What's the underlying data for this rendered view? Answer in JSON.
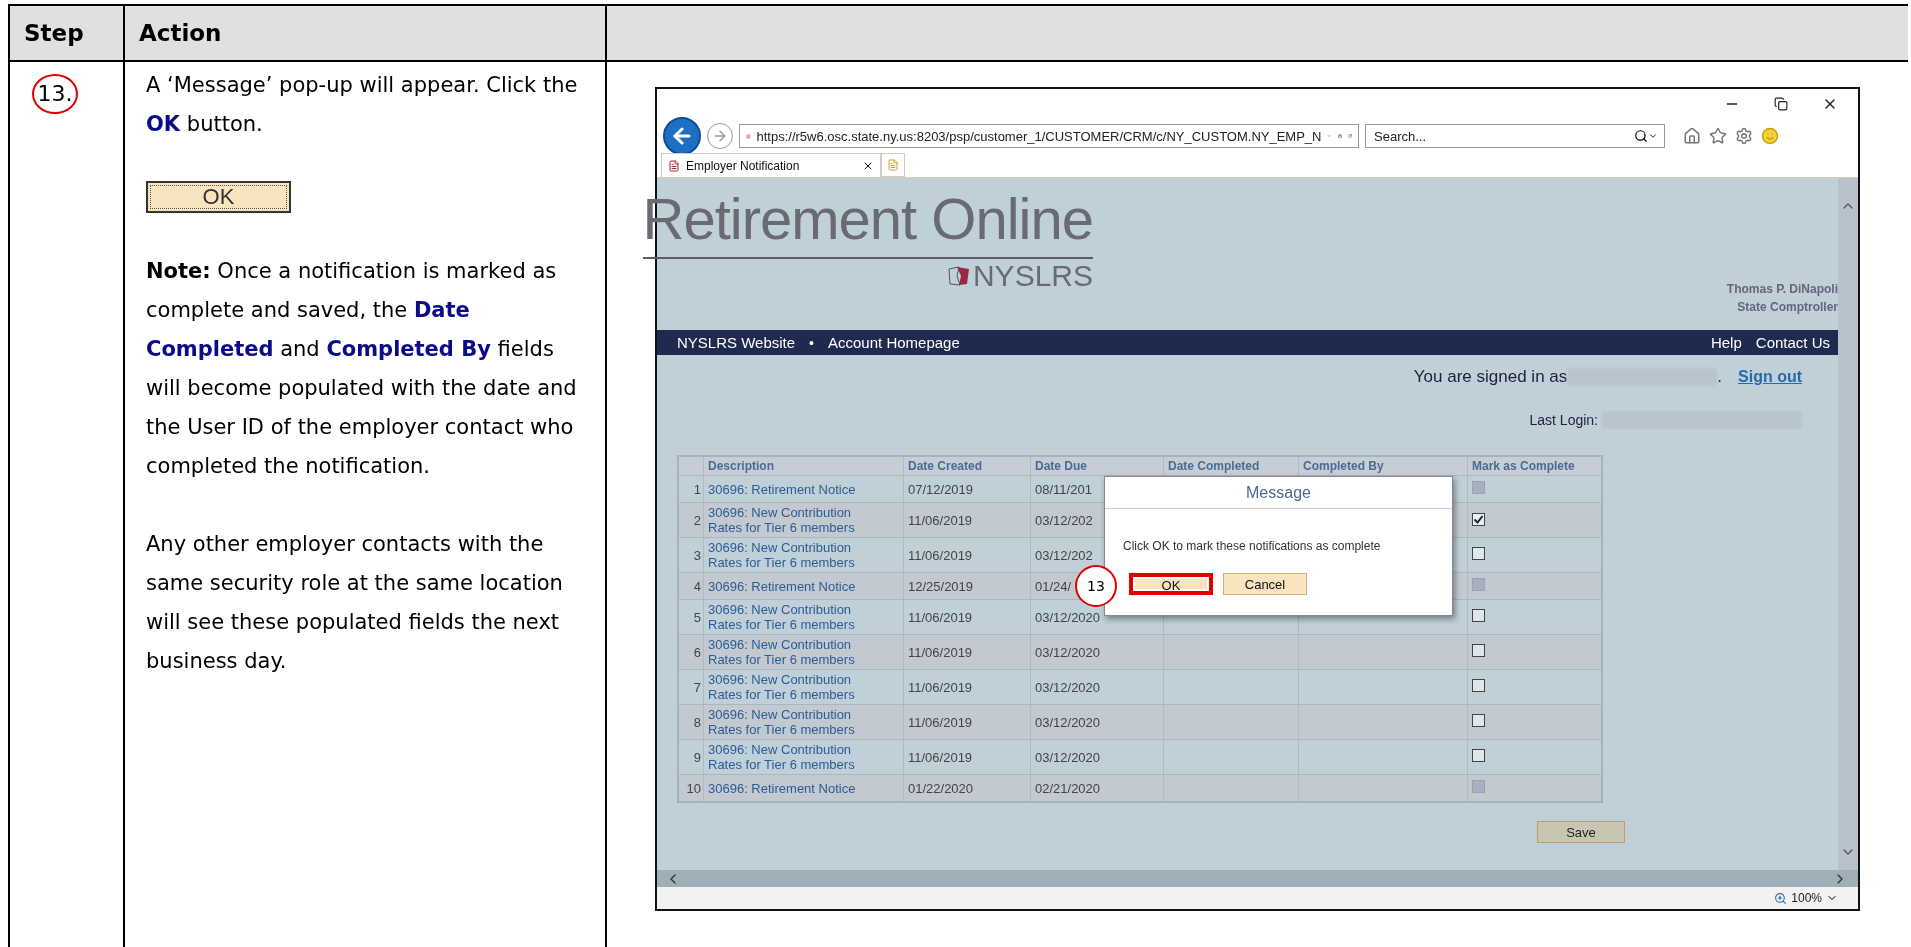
{
  "table": {
    "columns": [
      "Step",
      "Action"
    ]
  },
  "step": {
    "number": "13."
  },
  "instructions": [
    {
      "kind": "text",
      "segments": [
        {
          "kind": "plain",
          "text": "A ‘Message’ pop-up will appear.  Click the "
        },
        {
          "kind": "term",
          "text": "OK"
        },
        {
          "kind": "plain",
          "text": " button."
        }
      ]
    },
    {
      "kind": "button",
      "label": "OK"
    },
    {
      "kind": "text",
      "segments": [
        {
          "kind": "label",
          "text": "Note:"
        },
        {
          "kind": "plain",
          "text": " Once a notification is marked as complete and saved, the "
        },
        {
          "kind": "term",
          "text": "Date Completed"
        },
        {
          "kind": "plain",
          "text": " and "
        },
        {
          "kind": "term",
          "text": "Completed By"
        },
        {
          "kind": "plain",
          "text": " fields will become populated with the date and the User ID of the employer contact who completed the notification."
        }
      ]
    },
    {
      "kind": "text",
      "segments": [
        {
          "kind": "plain",
          "text": "Any other employer contacts with the same security role at the same location will see these populated fields the next business day."
        }
      ]
    }
  ],
  "browser": {
    "url": "https://r5w6.osc.state.ny.us:8203/psp/customer_1/CUSTOMER/CRM/c/NY_CUSTOM.NY_EMP_N",
    "search": {
      "placeholder": "Search..."
    },
    "tab": {
      "title": "Employer Notification"
    },
    "zoom": "100%"
  },
  "site": {
    "logo_title": "Retirement Online",
    "logo_subtitle": "NYSLRS",
    "official_name": "Thomas P. DiNapoli",
    "official_title": "State Comptroller",
    "nav_left": [
      "NYSLRS Website",
      "Account Homepage"
    ],
    "nav_separator": "•",
    "nav_right": [
      "Help",
      "Contact Us"
    ],
    "signed_in_label": "You are signed in as",
    "signed_in_period": ".",
    "sign_out": "Sign out",
    "last_login_label": "Last Login:"
  },
  "grid": {
    "columns": [
      "Description",
      "Date Created",
      "Date Due",
      "Date Completed",
      "Completed By",
      "Mark as Complete"
    ],
    "rows": [
      {
        "number": "1",
        "description": "30696: Retirement Notice",
        "date_created": "07/12/2019",
        "date_due": "08/11/201",
        "checked": false,
        "disabled": true
      },
      {
        "number": "2",
        "description": "30696: New Contribution Rates for Tier 6 members",
        "date_created": "11/06/2019",
        "date_due": "03/12/202",
        "checked": true,
        "disabled": false
      },
      {
        "number": "3",
        "description": "30696: New Contribution Rates for Tier 6 members",
        "date_created": "11/06/2019",
        "date_due": "03/12/202",
        "checked": false,
        "disabled": false
      },
      {
        "number": "4",
        "description": "30696: Retirement Notice",
        "date_created": "12/25/2019",
        "date_due": "01/24/",
        "checked": false,
        "disabled": true
      },
      {
        "number": "5",
        "description": "30696: New Contribution Rates for Tier 6 members",
        "date_created": "11/06/2019",
        "date_due": "03/12/2020",
        "checked": false,
        "disabled": false
      },
      {
        "number": "6",
        "description": "30696: New Contribution Rates for Tier 6 members",
        "date_created": "11/06/2019",
        "date_due": "03/12/2020",
        "checked": false,
        "disabled": false
      },
      {
        "number": "7",
        "description": "30696: New Contribution Rates for Tier 6 members",
        "date_created": "11/06/2019",
        "date_due": "03/12/2020",
        "checked": false,
        "disabled": false
      },
      {
        "number": "8",
        "description": "30696: New Contribution Rates for Tier 6 members",
        "date_created": "11/06/2019",
        "date_due": "03/12/2020",
        "checked": false,
        "disabled": false
      },
      {
        "number": "9",
        "description": "30696: New Contribution Rates for Tier 6 members",
        "date_created": "11/06/2019",
        "date_due": "03/12/2020",
        "checked": false,
        "disabled": false
      },
      {
        "number": "10",
        "description": "30696: Retirement Notice",
        "date_created": "01/22/2020",
        "date_due": "02/21/2020",
        "checked": false,
        "disabled": true
      }
    ]
  },
  "dialog": {
    "title": "Message",
    "message": "Click OK to mark these notifications as complete",
    "callout": "13",
    "buttons": [
      {
        "label": "OK",
        "highlighted": true
      },
      {
        "label": "Cancel",
        "highlighted": false
      }
    ]
  },
  "save_button": "Save"
}
